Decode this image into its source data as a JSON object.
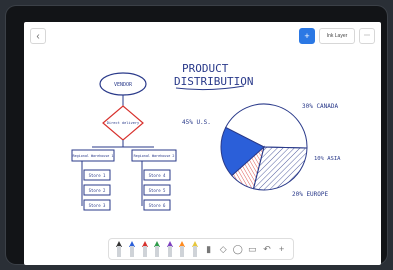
{
  "window": {
    "back_label": "‹",
    "topbar": {
      "add_label": "+",
      "share_label": "Ink Layer",
      "more_label": "⋯"
    }
  },
  "canvas": {
    "title_line1": "PRODUCT",
    "title_line2": "DISTRIBUTION",
    "flowchart": {
      "start_label": "VENDOR",
      "decision_label": "Direct delivery",
      "left_branch_label": "Regional Warehouse 1",
      "right_branch_label": "Regional Warehouse 2",
      "left_items": [
        "Store 1",
        "Store 2",
        "Store 3"
      ],
      "right_items": [
        "Store 4",
        "Store 5",
        "Store 6"
      ]
    },
    "pie_labels": {
      "left": "45% U.S.",
      "top_right": "30% CANADA",
      "right": "10% ASIA",
      "bottom_right": "20% EUROPE"
    }
  },
  "chart_data": {
    "type": "pie",
    "categories": [
      "U.S.",
      "CANADA",
      "ASIA",
      "EUROPE"
    ],
    "values": [
      45,
      30,
      10,
      20
    ]
  },
  "toolbar": {
    "pen_colors": [
      "#333333",
      "#2b5fd9",
      "#d7302c",
      "#2e9c4a",
      "#7c3fbf",
      "#ff8a1f",
      "#e6c63a"
    ],
    "tools": [
      "highlighter-icon",
      "eraser-icon",
      "lasso-icon",
      "ruler-icon",
      "undo-icon",
      "add-icon"
    ]
  }
}
